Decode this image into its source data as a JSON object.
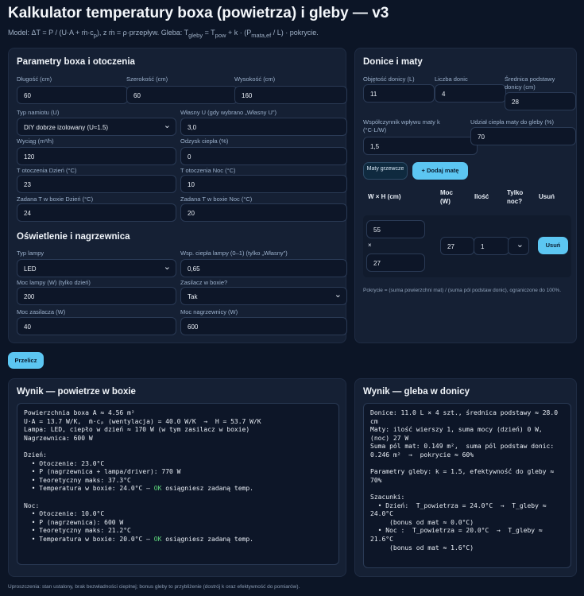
{
  "title": "Kalkulator temperatury boxa (powietrza) i gleby — v3",
  "model_parts": {
    "a": "Model: ΔT = P / (U·A + ṁ·c",
    "a_sub": "p",
    "b": "), z ṁ = ρ·przepływ. Gleba: T",
    "b_sub": "gleby",
    "c": " = T",
    "c_sub": "pow",
    "d": " + k · (P",
    "d_sub": "mata,ef",
    "e": " / L) · pokrycie."
  },
  "box": {
    "heading": "Parametry boxa i otoczenia",
    "length_label": "Długość (cm)",
    "length": "60",
    "width_label": "Szerokość (cm)",
    "width": "60",
    "height_label": "Wysokość (cm)",
    "height": "160",
    "tent_label": "Typ namiotu (U)",
    "tent": "DIY dobrze izolowany (U≈1.5)",
    "ownu_label": "Własny U (gdy wybrano „Własny U\")",
    "ownu": "3,0",
    "exhaust_label": "Wyciąg (m³/h)",
    "exhaust": "120",
    "recovery_label": "Odzysk ciepła (%)",
    "recovery": "0",
    "tday_label": "T otoczenia Dzień (°C)",
    "tday": "23",
    "tnight_label": "T otoczenia Noc (°C)",
    "tnight": "10",
    "setday_label": "Zadana T w boxie Dzień (°C)",
    "setday": "24",
    "setnight_label": "Zadana T w boxie Noc (°C)",
    "setnight": "20"
  },
  "light": {
    "heading": "Oświetlenie i nagrzewnica",
    "lamp_type_label": "Typ lampy",
    "lamp_type": "LED",
    "lamp_coef_label": "Wsp. ciepła lampy (0–1) (tylko „Własny\")",
    "lamp_coef": "0,65",
    "lamp_power_label": "Moc lampy (W) (tylko dzień)",
    "lamp_power": "200",
    "psu_in_label": "Zasilacz w boxie?",
    "psu_in": "Tak",
    "psu_power_label": "Moc zasilacza (W)",
    "psu_power": "40",
    "heater_label": "Moc nagrzewnicy (W)",
    "heater": "600"
  },
  "pots": {
    "heading": "Donice i maty",
    "volume_label": "Objętość donicy (L)",
    "volume": "11",
    "count_label": "Liczba donic",
    "count": "4",
    "diameter_label": "Średnica podstawy donicy (cm)",
    "diameter": "28",
    "coef_label": "Współczynnik wpływu maty k (°C·L/W)",
    "coef": "1,5",
    "share_label": "Udział ciepła maty do gleby (%)",
    "share": "70",
    "mats_button": "Maty grzewcze",
    "add_mat_button": "+ Dodaj matę",
    "col_wh": "W × H (cm)",
    "col_power": "Moc (W)",
    "col_qty": "Ilość",
    "col_night": "Tylko noc?",
    "col_remove": "Usuń",
    "mat_w": "55",
    "mat_x": "×",
    "mat_h": "27",
    "mat_power": "27",
    "mat_qty": "1",
    "mat_night": "",
    "remove_button": "Usuń",
    "note": "Pokrycie = (suma powierzchni mat) / (suma pól podstaw donic), ograniczone do 100%."
  },
  "calc_button": "Przelicz",
  "air": {
    "heading": "Wynik — powietrze w boxie",
    "pre1": "Powierzchnia boxa A ≈ 4.56 m²\nU·A = 13.7 W/K,  ṁ·cₚ (wentylacja) = 40.0 W/K  →  H = 53.7 W/K\nLampa: LED, ciepło w dzień ≈ 170 W (w tym zasilacz w boxie)\nNagrzewnica: 600 W\n\nDzień:\n  • Otoczenie: 23.0°C\n  • P (nagrzewnica + lampa/driver): 770 W\n  • Teoretyczny maks: 37.3°C\n  • Temperatura w boxie: 24.0°C — ",
    "ok1": "OK",
    "pre2": " osiągniesz zadaną temp.\n\nNoc:\n  • Otoczenie: 10.0°C\n  • P (nagrzewnica): 600 W\n  • Teoretyczny maks: 21.2°C\n  • Temperatura w boxie: 20.0°C — ",
    "ok2": "OK",
    "pre3": " osiągniesz zadaną temp."
  },
  "soil": {
    "heading": "Wynik — gleba w donicy",
    "text": "Donice: 11.0 L × 4 szt., średnica podstawy ≈ 28.0 cm\nMaty: ilość wierszy 1, suma mocy (dzień) 0 W, (noc) 27 W\nSuma pól mat: 0.149 m²,  suma pól podstaw donic: 0.246 m²  →  pokrycie ≈ 60%\n\nParametry gleby: k = 1.5, efektywność do gleby ≈ 70%\n\nSzacunki:\n  • Dzień:  T_powietrza = 24.0°C  →  T_gleby ≈ 24.0°C\n     (bonus od mat ≈ 0.0°C)\n  • Noc :  T_powietrza = 20.0°C  →  T_gleby ≈ 21.6°C\n     (bonus od mat ≈ 1.6°C)"
  },
  "footer": "Uproszczenia: stan ustalony, brak bezwładności cieplnej; bonus gleby to przybliżenie (dostrój k oraz efektywność do pomiarów)."
}
